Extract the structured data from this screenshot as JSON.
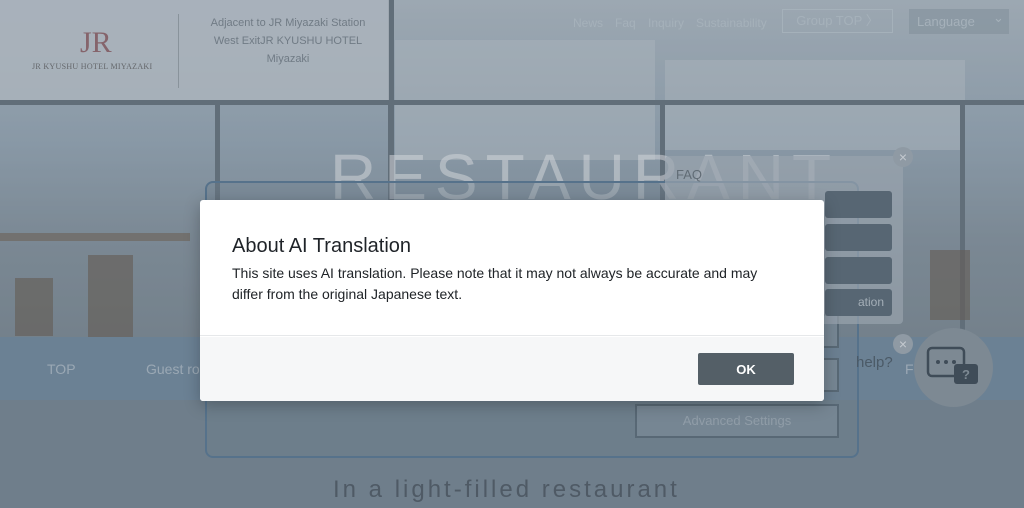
{
  "header": {
    "logo_mark": "JR",
    "logo_text": "JR KYUSHU HOTEL MIYAZAKI",
    "address": "Adjacent to JR Miyazaki Station West ExitJR KYUSHU HOTEL Miyazaki",
    "nav": [
      "News",
      "Faq",
      "Inquiry",
      "Sustainability"
    ],
    "group_top": "Group TOP",
    "group_top_arrow": "〉",
    "language": "Language",
    "language_chevron": "⌄"
  },
  "hero": {
    "title": "RESTAURANT"
  },
  "navbar": {
    "items": [
      "TOP",
      "Guest ro"
    ]
  },
  "accessibility": {
    "advanced_settings": "Advanced Settings"
  },
  "faq": {
    "title": "FAQ",
    "item_partial": "ation",
    "close": "×"
  },
  "help": {
    "text": "help?",
    "partial": "F",
    "close": "×"
  },
  "lower": {
    "tagline": "In a light-filled restaurant"
  },
  "modal": {
    "title": "About AI Translation",
    "text": "This site uses AI translation. Please note that it may not always be accurate and may differ from the original Japanese text.",
    "ok_label": "OK"
  }
}
